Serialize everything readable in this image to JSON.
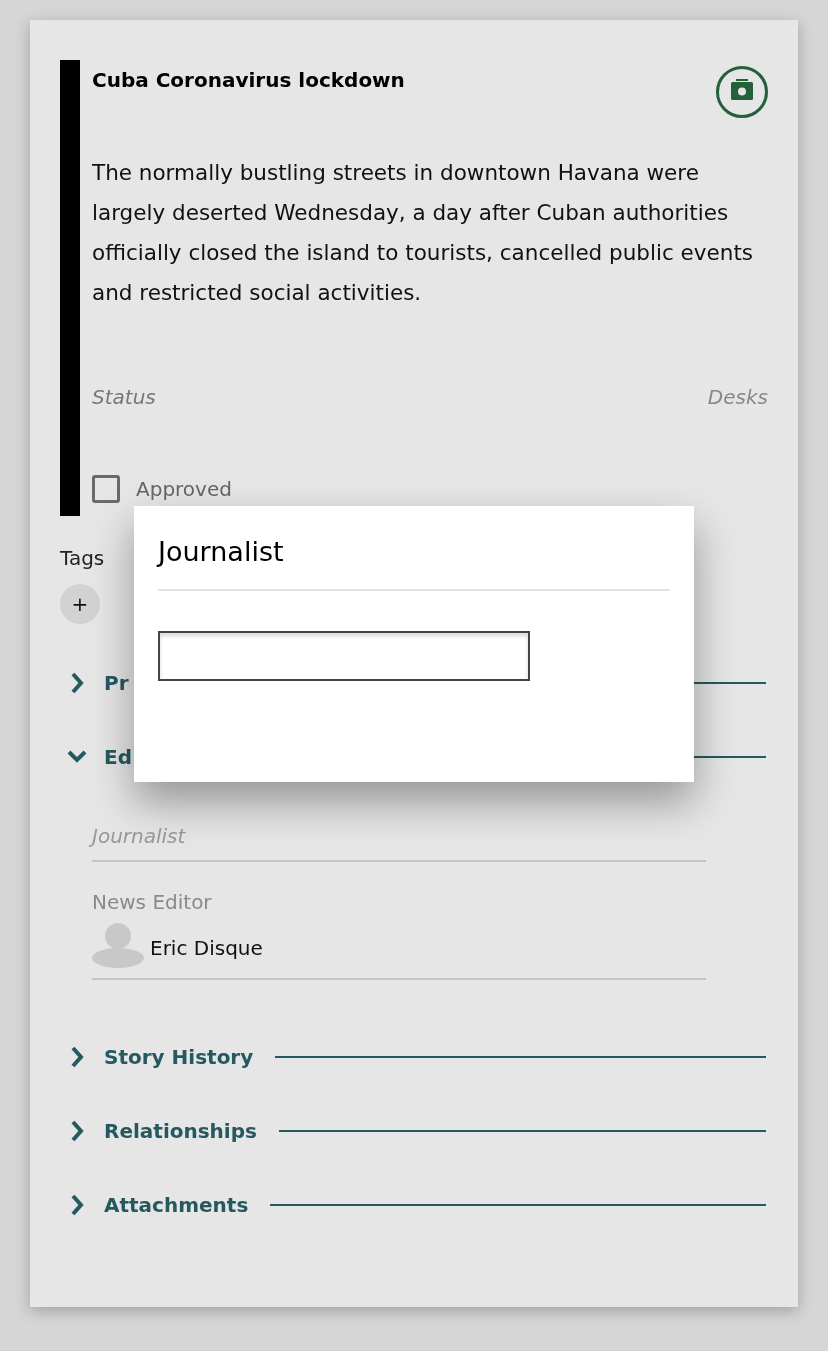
{
  "story": {
    "title": "Cuba Coronavirus lockdown",
    "description": "The normally bustling streets in downtown Havana were largely deserted Wednesday, a day after Cuban authorities officially closed the island to tourists, cancelled public events and restricted social activities.",
    "status_label": "Status",
    "desks_label": "Desks",
    "approved": {
      "label": "Approved",
      "checked": false
    }
  },
  "tags": {
    "label": "Tags",
    "add": "+"
  },
  "sections": [
    {
      "label": "Pr",
      "expanded": false
    },
    {
      "label": "Ed",
      "expanded": true,
      "fields": [
        {
          "kind": "input",
          "placeholder": "Journalist"
        },
        {
          "kind": "person",
          "label": "News Editor",
          "name": "Eric Disque"
        }
      ]
    },
    {
      "label": "Story History",
      "expanded": false
    },
    {
      "label": "Relationships",
      "expanded": false
    },
    {
      "label": "Attachments",
      "expanded": false
    }
  ],
  "dialog": {
    "title": "Journalist"
  }
}
